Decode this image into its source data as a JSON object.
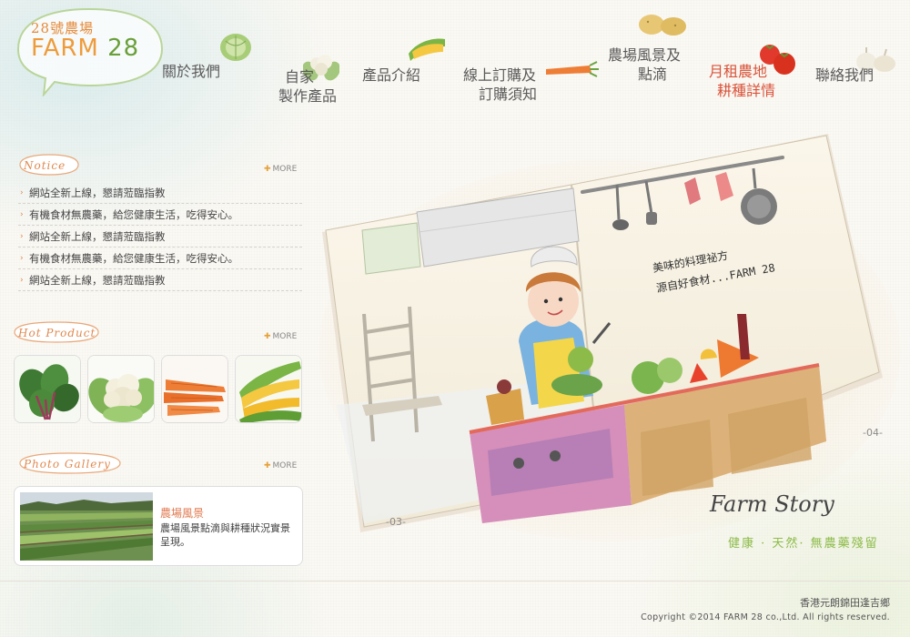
{
  "logo": {
    "chinese": "28號農場",
    "english": "FARM",
    "number": "28"
  },
  "nav": [
    {
      "lines": [
        "關於我們"
      ],
      "icon": "cabbage-icon"
    },
    {
      "lines": [
        "自家",
        "製作產品"
      ],
      "icon": "cauliflower-icon"
    },
    {
      "lines": [
        "產品介紹"
      ],
      "icon": "corn-icon"
    },
    {
      "lines": [
        "線上訂購及",
        "訂購須知"
      ],
      "icon": "carrot-icon"
    },
    {
      "lines": [
        "農場風景及",
        "點滴"
      ],
      "icon": "potato-icon"
    },
    {
      "lines": [
        "月租農地",
        "耕種詳情"
      ],
      "icon": "tomato-icon"
    },
    {
      "lines": [
        "聯絡我們"
      ],
      "icon": "garlic-icon"
    }
  ],
  "notice": {
    "title": "Notice",
    "more": "MORE",
    "items": [
      "網站全新上線，懇請蒞臨指教",
      "有機食材無農藥，給您健康生活，吃得安心。",
      "網站全新上線，懇請蒞臨指教",
      "有機食材無農藥，給您健康生活，吃得安心。",
      "網站全新上線，懇請蒞臨指教"
    ]
  },
  "hot_product": {
    "title": "Hot Product",
    "more": "MORE",
    "items": [
      "spinach-image",
      "cauliflower-image",
      "carrot-image",
      "corn-image"
    ]
  },
  "gallery": {
    "title": "Photo Gallery",
    "more": "MORE",
    "card_title": "農場風景",
    "card_desc": "農場風景點滴與耕種狀況實景呈現。"
  },
  "story": {
    "note_line1": "美味的料理祕方",
    "note_line2": "源自好食材...FARM 28",
    "page_left": "-03-",
    "page_right": "-04-",
    "title": "Farm Story",
    "subtitle": "健康 · 天然· 無農藥殘留"
  },
  "footer": {
    "address": "香港元朗錦田逢吉鄉",
    "copyright": "Copyright ©2014 FARM 28 co.,Ltd. All rights reserved."
  },
  "colors": {
    "accent": "#e0894f",
    "green": "#8dbb4a",
    "text": "#444444"
  }
}
